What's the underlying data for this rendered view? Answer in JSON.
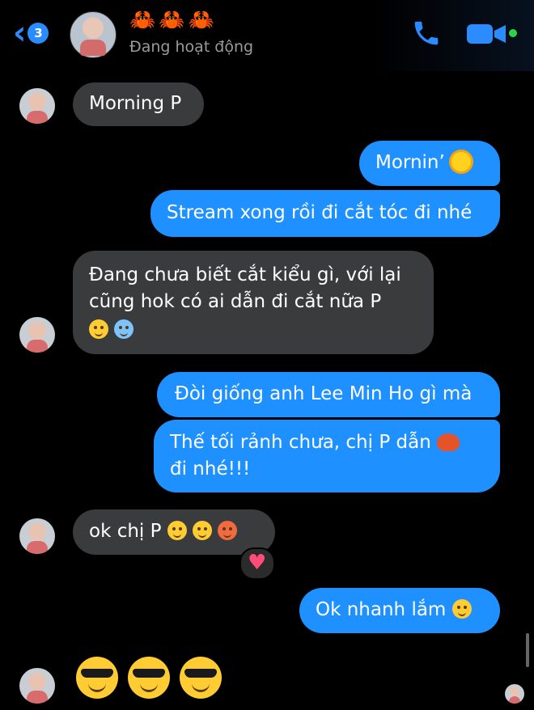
{
  "header": {
    "back_count": "3",
    "title_emojis": "🦀🦀🦀",
    "status": "Đang hoạt động",
    "icons": {
      "back": "chevron-left-icon",
      "call": "phone-icon",
      "video": "video-camera-icon"
    },
    "accent": "#2a8cff",
    "online_color": "#2bd24a"
  },
  "messages": [
    {
      "side": "in",
      "text": "Morning P"
    },
    {
      "side": "out",
      "text": "Mornin’"
    },
    {
      "side": "out",
      "text": "Stream xong rồi đi cắt tóc đi nhé"
    },
    {
      "side": "in",
      "lines": [
        "Đang chưa biết cắt kiểu gì, với lại",
        "cũng hok có ai dẫn đi cắt nữa P"
      ],
      "emojis": [
        "eye-roll-emoji",
        "crying-emoji"
      ]
    },
    {
      "side": "out",
      "text": "Đòi giống anh Lee Min Ho gì mà"
    },
    {
      "side": "out",
      "lines": [
        "Thế tối rảnh chưa, chị P dẫn",
        "đi nhé!!!"
      ],
      "emoji": "crab-emoji"
    },
    {
      "side": "in",
      "text": "ok chị P",
      "emojis": [
        "upside-down-face-emoji",
        "hugging-face-emoji",
        "angry-face-emoji"
      ],
      "reaction": "heart-icon"
    },
    {
      "side": "out",
      "text": "Ok nhanh lắm",
      "emoji": "unamused-face-emoji"
    },
    {
      "side": "in",
      "emojis": [
        "sunglasses-face-emoji",
        "sunglasses-face-emoji",
        "sunglasses-face-emoji"
      ]
    }
  ],
  "colors": {
    "incoming": "#3a3b3c",
    "outgoing": "#1e90ff",
    "background": "#000000"
  }
}
